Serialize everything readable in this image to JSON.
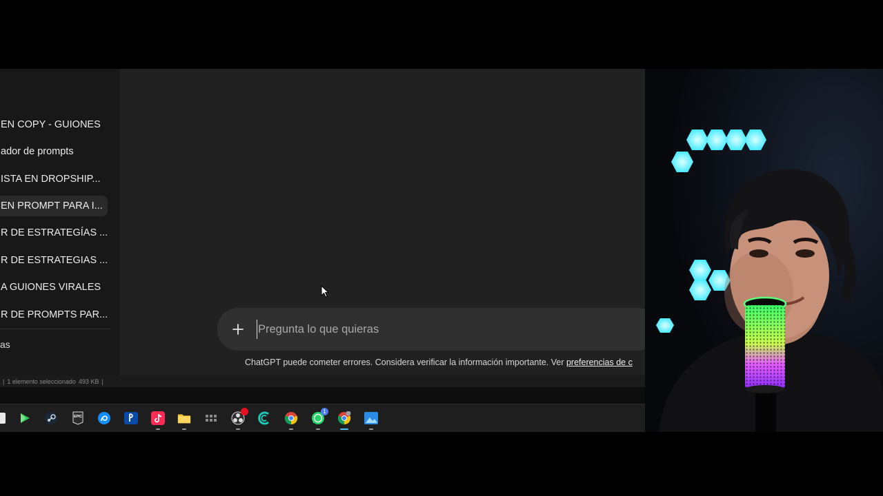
{
  "sidebar": {
    "items": [
      {
        "label": "EN COPY - GUIONES",
        "active": false
      },
      {
        "label": "ador de prompts",
        "active": false
      },
      {
        "label": "ISTA EN DROPSHIP...",
        "active": false
      },
      {
        "label": "EN PROMPT PARA I...",
        "active": true
      },
      {
        "label": "R DE ESTRATEGÍAS ...",
        "active": false
      },
      {
        "label": "R DE ESTRATEGIAS ...",
        "active": false
      },
      {
        "label": "A GUIONES VIRALES",
        "active": false
      },
      {
        "label": "R DE PROMPTS PAR...",
        "active": false
      }
    ],
    "more_label": "as"
  },
  "composer": {
    "placeholder": "Pregunta lo que quieras",
    "value": ""
  },
  "disclaimer": {
    "text": "ChatGPT puede cometer errores. Considera verificar la información importante. Ver ",
    "link": "preferencias de c"
  },
  "statusbar": {
    "selection": "1 elemento seleccionado",
    "size": "493 KB"
  },
  "taskbar": {
    "icons": [
      "file-icon",
      "play-store-icon",
      "steam-icon",
      "epic-games-icon",
      "battlenet-icon",
      "playstation-icon",
      "tiktok-icon",
      "file-explorer-icon",
      "apps-grid-icon",
      "obs-icon",
      "capcut-icon",
      "chrome-icon",
      "whatsapp-icon",
      "chrome-profile-icon",
      "photos-icon"
    ],
    "whatsapp_badge": "1"
  },
  "colors": {
    "page": "#000000",
    "sidebar": "#181818",
    "main": "#212121",
    "composer": "#303030",
    "taskbar": "#1e1e1e",
    "hex_light": "#3ff0ff"
  }
}
